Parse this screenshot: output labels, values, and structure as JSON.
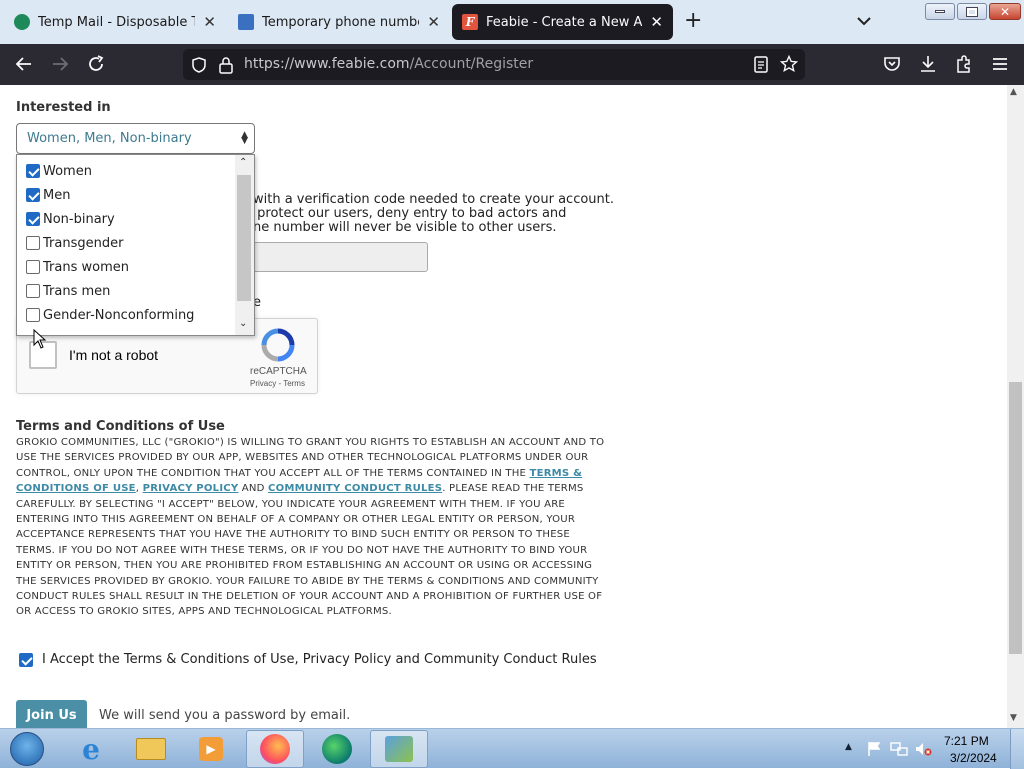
{
  "browser": {
    "tabs": [
      {
        "label": "Temp Mail - Disposable Tempo",
        "icon": "tempmail-icon",
        "active": false
      },
      {
        "label": "Temporary phone number | Rec",
        "icon": "mail-icon",
        "active": false
      },
      {
        "label": "Feabie - Create a New Account",
        "icon": "feabie-icon",
        "active": true
      }
    ],
    "url_host": "https://www.feabie.com",
    "url_path": "/Account/Register"
  },
  "form": {
    "interested_label": "Interested in",
    "interested_value": "Women, Men, Non-binary",
    "options": [
      {
        "label": "Women",
        "checked": true
      },
      {
        "label": "Men",
        "checked": true
      },
      {
        "label": "Non-binary",
        "checked": true
      },
      {
        "label": "Transgender",
        "checked": false
      },
      {
        "label": "Trans women",
        "checked": false
      },
      {
        "label": "Trans men",
        "checked": false
      },
      {
        "label": "Gender-Nonconforming",
        "checked": false
      }
    ],
    "verify_line1": "with a verification code needed to create your account.",
    "verify_line2": " protect our users, deny entry to bad actors and",
    "verify_line3": "ne number will never be visible to other users.",
    "e_fragment": "e",
    "recaptcha": {
      "label": "I'm not a robot",
      "brand": "reCAPTCHA",
      "links": "Privacy - Terms"
    },
    "terms_title": "Terms and Conditions of Use",
    "terms_part1": "GROKIO COMMUNITIES, LLC (\"GROKIO\") IS WILLING TO GRANT YOU RIGHTS TO ESTABLISH AN ACCOUNT AND TO USE THE SERVICES PROVIDED BY OUR APP, WEBSITES AND OTHER TECHNOLOGICAL PLATFORMS UNDER OUR CONTROL, ONLY UPON THE CONDITION THAT YOU ACCEPT ALL OF THE TERMS CONTAINED IN THE ",
    "terms_link1": "TERMS & CONDITIONS OF USE",
    "terms_sep1": ", ",
    "terms_link2": "PRIVACY POLICY",
    "terms_and": " AND ",
    "terms_link3": "COMMUNITY CONDUCT RULES",
    "terms_part2": ". PLEASE READ THE TERMS CAREFULLY. BY SELECTING \"I ACCEPT\" BELOW, YOU INDICATE YOUR AGREEMENT WITH THEM. IF YOU ARE ENTERING INTO THIS AGREEMENT ON BEHALF OF A COMPANY OR OTHER LEGAL ENTITY OR PERSON, YOUR ACCEPTANCE REPRESENTS THAT YOU HAVE THE AUTHORITY TO BIND SUCH ENTITY OR PERSON TO THESE TERMS. IF YOU DO NOT AGREE WITH THESE TERMS, OR IF YOU DO NOT HAVE THE AUTHORITY TO BIND YOUR ENTITY OR PERSON, THEN YOU ARE PROHIBITED FROM ESTABLISHING AN ACCOUNT OR USING OR ACCESSING THE SERVICES PROVIDED BY GROKIO. YOUR FAILURE TO ABIDE BY THE TERMS & CONDITIONS AND COMMUNITY CONDUCT RULES SHALL RESULT IN THE DELETION OF YOUR ACCOUNT AND A PROHIBITION OF FURTHER USE OF OR ACCESS TO GROKIO SITES, APPS AND TECHNOLOGICAL PLATFORMS.",
    "accept_label": "I Accept the Terms & Conditions of Use, Privacy Policy and Community Conduct Rules",
    "accept_checked": true,
    "join_label": "Join Us",
    "email_note": "We will send you a password by email."
  },
  "taskbar": {
    "apps": [
      "start-orb",
      "internet-explorer-icon",
      "file-explorer-icon",
      "media-player-icon",
      "firefox-icon",
      "edge-icon",
      "control-panel-icon"
    ],
    "time": "7:21 PM",
    "date": "3/2/2024"
  },
  "colors": {
    "accent": "#4a8fa6",
    "checkbox": "#1e6ac4",
    "toolbar": "#2b2a33",
    "active_tab": "#1c1b22"
  }
}
